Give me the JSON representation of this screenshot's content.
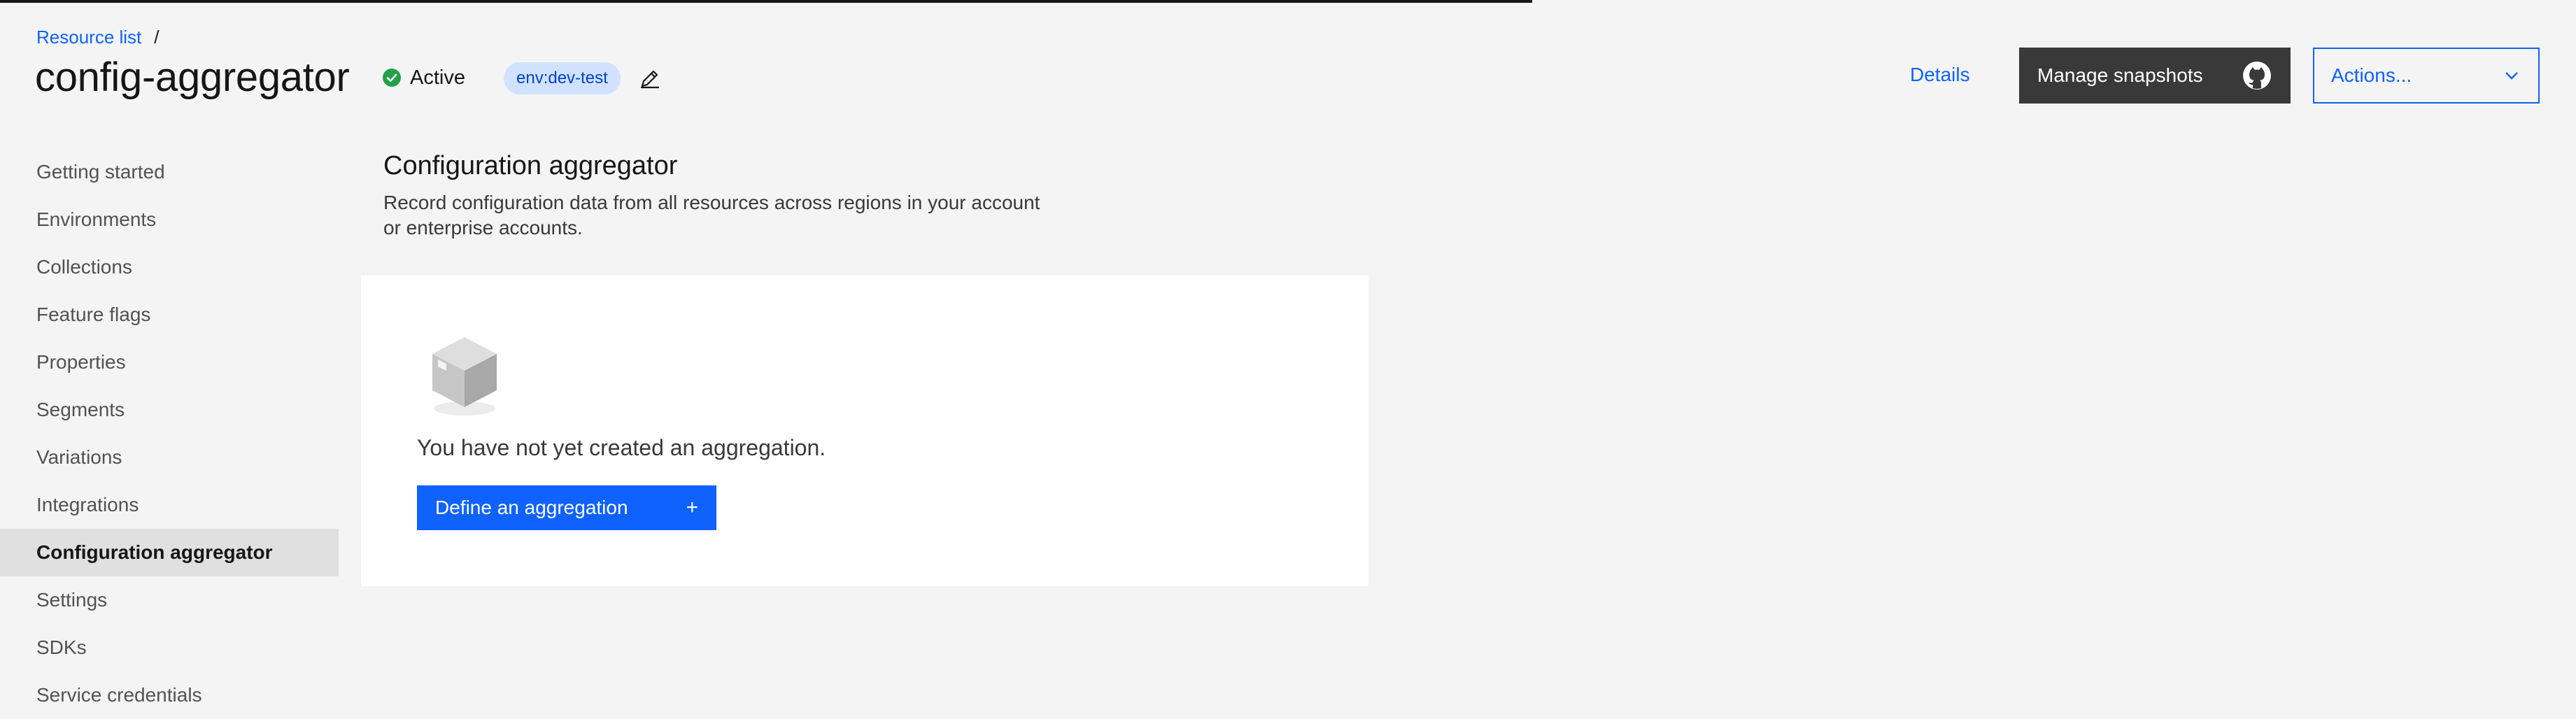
{
  "header": {
    "breadcrumb": {
      "link_label": "Resource list",
      "separator": "/"
    },
    "title": "config-aggregator",
    "status": {
      "label": "Active",
      "icon": "checkmark-filled-icon",
      "color": "#24a148"
    },
    "tag": {
      "label": "env:dev-test",
      "background": "#d0e2ff",
      "color": "#0043ce"
    },
    "edit_icon": "edit-icon",
    "details_label": "Details",
    "manage_snapshots": {
      "label": "Manage snapshots",
      "icon": "github-icon"
    },
    "actions": {
      "label": "Actions...",
      "icon": "chevron-down-icon"
    }
  },
  "sidebar": {
    "items": [
      {
        "label": "Getting started",
        "active": false
      },
      {
        "label": "Environments",
        "active": false
      },
      {
        "label": "Collections",
        "active": false
      },
      {
        "label": "Feature flags",
        "active": false
      },
      {
        "label": "Properties",
        "active": false
      },
      {
        "label": "Segments",
        "active": false
      },
      {
        "label": "Variations",
        "active": false
      },
      {
        "label": "Integrations",
        "active": false
      },
      {
        "label": "Configuration aggregator",
        "active": true
      },
      {
        "label": "Settings",
        "active": false
      },
      {
        "label": "SDKs",
        "active": false
      },
      {
        "label": "Service credentials",
        "active": false
      }
    ]
  },
  "main": {
    "title": "Configuration aggregator",
    "description_line1": "Record configuration data from all resources across regions in your account",
    "description_line2": "or enterprise accounts.",
    "empty_state": {
      "illustration": "cube-icon",
      "message": "You have not yet created an aggregation.",
      "button_label": "Define an aggregation",
      "button_icon": "plus-icon",
      "button_icon_glyph": "+"
    }
  },
  "colors": {
    "accent": "#0f62fe",
    "background": "#f4f4f4",
    "panel": "#ffffff",
    "dark_button": "#393939"
  }
}
